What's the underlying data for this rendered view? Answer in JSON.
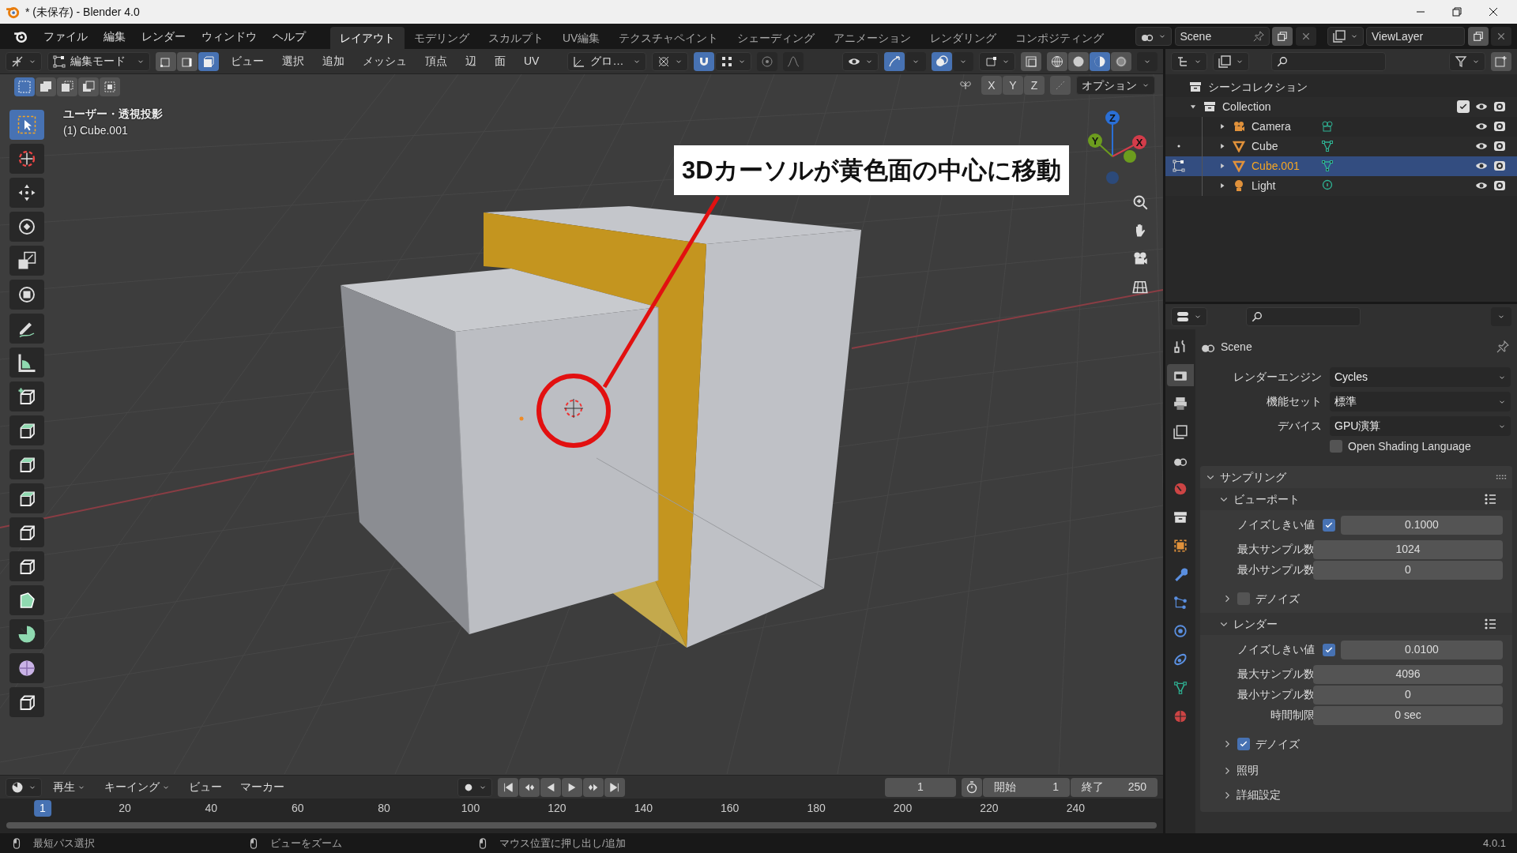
{
  "window": {
    "title": "* (未保存) - Blender 4.0"
  },
  "menu": [
    "ファイル",
    "編集",
    "レンダー",
    "ウィンドウ",
    "ヘルプ"
  ],
  "workspaces": [
    {
      "label": "レイアウト",
      "selected": true
    },
    {
      "label": "モデリング",
      "selected": false
    },
    {
      "label": "スカルプト",
      "selected": false
    },
    {
      "label": "UV編集",
      "selected": false
    },
    {
      "label": "テクスチャペイント",
      "selected": false
    },
    {
      "label": "シェーディング",
      "selected": false
    },
    {
      "label": "アニメーション",
      "selected": false
    },
    {
      "label": "レンダリング",
      "selected": false
    },
    {
      "label": "コンポジティング",
      "selected": false
    }
  ],
  "scene": "Scene",
  "view_layer": "ViewLayer",
  "header": {
    "mode": "編集モード",
    "select_modes": [
      {
        "selected": false
      },
      {
        "selected": false
      },
      {
        "selected": true
      }
    ],
    "menus": [
      "ビュー",
      "選択",
      "追加",
      "メッシュ",
      "頂点",
      "辺",
      "面",
      "UV"
    ],
    "orientation": "グロ…",
    "snap": {
      "on": true
    },
    "shading": [
      {
        "selected": false
      },
      {
        "selected": false
      },
      {
        "selected": true
      },
      {
        "selected": false
      }
    ]
  },
  "tool_settings": {
    "box_modes": [
      {
        "selected": true
      },
      {
        "selected": false
      },
      {
        "selected": false
      },
      {
        "selected": false
      },
      {
        "selected": false
      }
    ],
    "axes": [
      "X",
      "Y",
      "Z"
    ],
    "options": "オプション"
  },
  "tools": [
    {
      "selected": true
    },
    {
      "selected": false
    },
    {
      "selected": false
    },
    {
      "selected": false
    },
    {
      "selected": false
    },
    {
      "selected": false
    },
    {
      "selected": false
    },
    {
      "selected": false
    },
    {
      "selected": false
    },
    {
      "selected": false
    },
    {
      "selected": false
    },
    {
      "selected": false
    },
    {
      "selected": false
    },
    {
      "selected": false
    },
    {
      "selected": false
    },
    {
      "selected": false
    },
    {
      "selected": false
    },
    {
      "selected": false
    }
  ],
  "viewport": {
    "view_name": "ユーザー・透視投影",
    "object": "(1) Cube.001",
    "callout": "3Dカーソルが黄色面の中心に移動",
    "gizmo_axes": [
      "Z",
      "Y",
      "X"
    ]
  },
  "outliner": {
    "root": "シーンコレクション",
    "collection": {
      "name": "Collection",
      "expanded": true,
      "checked": true,
      "children": [
        {
          "name": "Camera",
          "kind": "camera",
          "selected": false,
          "in_edit_mode": false
        },
        {
          "name": "Cube",
          "kind": "mesh",
          "selected": false,
          "in_edit_mode": false
        },
        {
          "name": "Cube.001",
          "kind": "mesh",
          "selected": true,
          "in_edit_mode": true
        },
        {
          "name": "Light",
          "kind": "light",
          "selected": false,
          "in_edit_mode": false
        }
      ]
    }
  },
  "property_tabs": [
    {
      "selected": false
    },
    {
      "selected": true
    },
    {
      "selected": false
    },
    {
      "selected": false
    },
    {
      "selected": false
    },
    {
      "selected": false
    },
    {
      "selected": false
    },
    {
      "selected": false
    },
    {
      "selected": false
    },
    {
      "selected": false
    },
    {
      "selected": false
    },
    {
      "selected": false
    },
    {
      "selected": false
    },
    {
      "selected": false
    }
  ],
  "properties": {
    "context": "Scene",
    "settings": [
      {
        "label": "レンダーエンジン",
        "value": "Cycles"
      },
      {
        "label": "機能セット",
        "value": "標準"
      },
      {
        "label": "デバイス",
        "value": "GPU演算"
      }
    ],
    "osl": {
      "label": "Open Shading Language",
      "checked": false
    },
    "sampling": {
      "title": "サンプリング",
      "expanded": true,
      "subpanels": [
        {
          "title": "ビューポート",
          "expanded": true,
          "rows": [
            {
              "kind": "toggle-number",
              "label": "ノイズしきい値",
              "checked": true,
              "value": "0.1000"
            },
            {
              "kind": "number",
              "label": "最大サンプル数",
              "value": "1024"
            },
            {
              "kind": "number",
              "label": "最小サンプル数",
              "value": "0"
            }
          ],
          "denoise": {
            "label": "デノイズ",
            "checked": false,
            "expanded": false
          }
        },
        {
          "title": "レンダー",
          "expanded": true,
          "rows": [
            {
              "kind": "toggle-number",
              "label": "ノイズしきい値",
              "checked": true,
              "value": "0.0100"
            },
            {
              "kind": "number",
              "label": "最大サンプル数",
              "value": "4096"
            },
            {
              "kind": "number",
              "label": "最小サンプル数",
              "value": "0"
            },
            {
              "kind": "number",
              "label": "時間制限",
              "value": "0 sec"
            }
          ],
          "denoise": {
            "label": "デノイズ",
            "checked": true,
            "expanded": false
          }
        }
      ],
      "more": [
        {
          "title": "照明",
          "expanded": false
        },
        {
          "title": "詳細設定",
          "expanded": false
        }
      ]
    }
  },
  "timeline": {
    "menus": [
      "再生",
      "キーイング",
      "ビュー",
      "マーカー"
    ],
    "current_frame": "1",
    "start_label": "開始",
    "start": "1",
    "end_label": "終了",
    "end": "250",
    "playhead": "1",
    "ticks": [
      "20",
      "40",
      "60",
      "80",
      "100",
      "120",
      "140",
      "160",
      "180",
      "200",
      "220",
      "240"
    ]
  },
  "status_bar": {
    "hints": [
      "最短パス選択",
      "ビューをズーム",
      "マウス位置に押し出し/追加"
    ],
    "version": "4.0.1"
  }
}
